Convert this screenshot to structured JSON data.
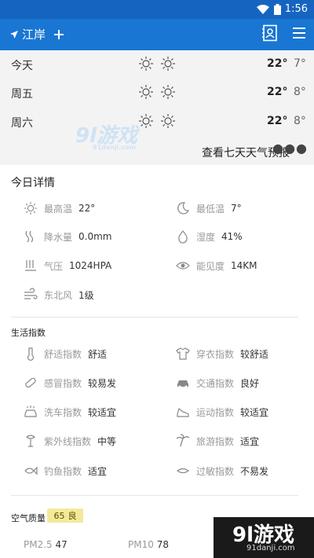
{
  "status_bar": {
    "time": "1:56"
  },
  "app_bar": {
    "location": "江岸"
  },
  "forecast": {
    "days": [
      {
        "day": "今天",
        "high": "22°",
        "low": "7°"
      },
      {
        "day": "周五",
        "high": "22°",
        "low": "8°"
      },
      {
        "day": "周六",
        "high": "22°",
        "low": "8°"
      }
    ],
    "more_link": "查看七天天气预报"
  },
  "watermark": {
    "text": "9l游戏",
    "sub": "91danji.com"
  },
  "today_details": {
    "title": "今日详情",
    "items": [
      {
        "label": "最高温",
        "value": "22°"
      },
      {
        "label": "最低温",
        "value": "7°"
      },
      {
        "label": "降水量",
        "value": "0.0mm"
      },
      {
        "label": "湿度",
        "value": "41%"
      },
      {
        "label": "气压",
        "value": "1024HPA"
      },
      {
        "label": "能见度",
        "value": "14KM"
      },
      {
        "label": "东北风",
        "value": "1级"
      }
    ]
  },
  "life_index": {
    "title": "生活指数",
    "items": [
      {
        "label": "舒适指数",
        "value": "舒适"
      },
      {
        "label": "穿衣指数",
        "value": "较舒适"
      },
      {
        "label": "感冒指数",
        "value": "较易发"
      },
      {
        "label": "交通指数",
        "value": "良好"
      },
      {
        "label": "洗车指数",
        "value": "较适宜"
      },
      {
        "label": "运动指数",
        "value": "较适宜"
      },
      {
        "label": "紫外线指数",
        "value": "中等"
      },
      {
        "label": "旅游指数",
        "value": "适宜"
      },
      {
        "label": "钓鱼指数",
        "value": "适宜"
      },
      {
        "label": "过敏指数",
        "value": "不易发"
      }
    ]
  },
  "air_quality": {
    "title": "空气质量",
    "aqi": "65",
    "level": "良",
    "pm25_label": "PM2.5",
    "pm25": "47",
    "pm10_label": "PM10",
    "pm10": "78"
  },
  "corner_logo": {
    "text": "9l游戏",
    "sub": "91danji.com"
  },
  "colors": {
    "primary": "#1976d2",
    "status": "#1565c0",
    "aqi_badge": "#f4e99a"
  }
}
